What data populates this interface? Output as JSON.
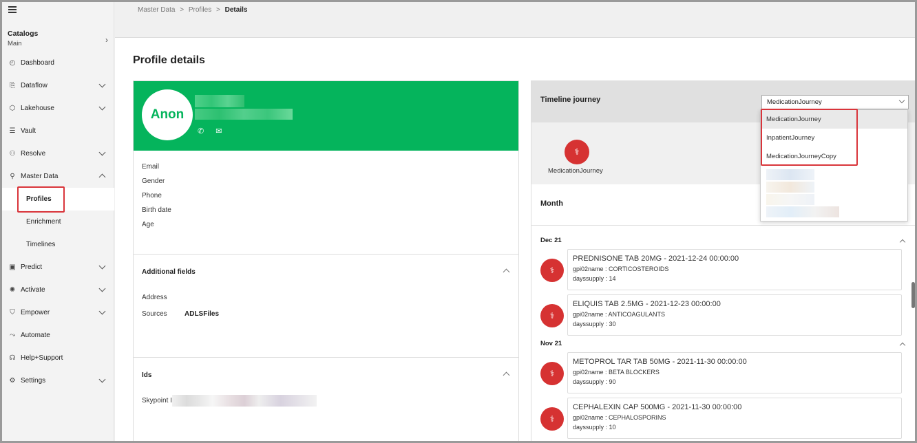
{
  "sidebar": {
    "catalog_title": "Catalogs",
    "catalog_sub": "Main",
    "items": [
      {
        "label": "Dashboard",
        "icon": "dashboard-icon",
        "glyph": "◴",
        "chevron": false
      },
      {
        "label": "Dataflow",
        "icon": "dataflow-icon",
        "glyph": "⎘",
        "chevron": true
      },
      {
        "label": "Lakehouse",
        "icon": "lakehouse-icon",
        "glyph": "⬡",
        "chevron": true
      },
      {
        "label": "Vault",
        "icon": "vault-icon",
        "glyph": "☰",
        "chevron": false
      },
      {
        "label": "Resolve",
        "icon": "resolve-icon",
        "glyph": "⚇",
        "chevron": true
      },
      {
        "label": "Master Data",
        "icon": "master-data-icon",
        "glyph": "⚲",
        "chevron": "up"
      }
    ],
    "sub_items": [
      "Profiles",
      "Enrichment",
      "Timelines"
    ],
    "items2": [
      {
        "label": "Predict",
        "icon": "predict-icon",
        "glyph": "▣",
        "chevron": true
      },
      {
        "label": "Activate",
        "icon": "activate-icon",
        "glyph": "✺",
        "chevron": true
      },
      {
        "label": "Empower",
        "icon": "empower-icon",
        "glyph": "⛉",
        "chevron": true
      },
      {
        "label": "Automate",
        "icon": "automate-icon",
        "glyph": "⤳",
        "chevron": false
      },
      {
        "label": "Help+Support",
        "icon": "help-icon",
        "glyph": "☊",
        "chevron": false
      },
      {
        "label": "Settings",
        "icon": "settings-icon",
        "glyph": "⚙",
        "chevron": true
      }
    ]
  },
  "breadcrumb": {
    "c1": "Master Data",
    "c2": "Profiles",
    "c3": "Details",
    "sep": ">"
  },
  "page_title": "Profile details",
  "profile": {
    "avatar": "Anon",
    "phone_icon": "✆",
    "mail_icon": "✉",
    "fields": [
      "Email",
      "Gender",
      "Phone",
      "Birth date",
      "Age"
    ],
    "additional_title": "Additional fields",
    "address_label": "Address",
    "sources_label": "Sources",
    "sources_value": "ADLSFiles",
    "ids_title": "Ids",
    "skypoint_label": "Skypoint I"
  },
  "timeline": {
    "title": "Timeline journey",
    "selected": "MedicationJourney",
    "options": [
      "MedicationJourney",
      "InpatientJourney",
      "MedicationJourneyCopy"
    ],
    "journey_label": "MedicationJourney",
    "month_label": "Month",
    "stetho": "⚕",
    "groups": [
      {
        "month": "Dec 21",
        "entries": [
          {
            "title": "PREDNISONE TAB 20MG - 2021-12-24 00:00:00",
            "gpi": "gpi02name : CORTICOSTEROIDS",
            "days": "dayssupply : 14"
          },
          {
            "title": "ELIQUIS TAB 2.5MG - 2021-12-23 00:00:00",
            "gpi": "gpi02name : ANTICOAGULANTS",
            "days": "dayssupply : 30"
          }
        ]
      },
      {
        "month": "Nov 21",
        "entries": [
          {
            "title": "METOPROL TAR TAB 50MG - 2021-11-30 00:00:00",
            "gpi": "gpi02name : BETA BLOCKERS",
            "days": "dayssupply : 90"
          },
          {
            "title": "CEPHALEXIN CAP 500MG - 2021-11-30 00:00:00",
            "gpi": "gpi02name : CEPHALOSPORINS",
            "days": "dayssupply : 10"
          }
        ]
      }
    ]
  },
  "colors": {
    "accent_green": "#05b45c",
    "accent_red": "#d63232",
    "highlight": "#d9343a"
  }
}
